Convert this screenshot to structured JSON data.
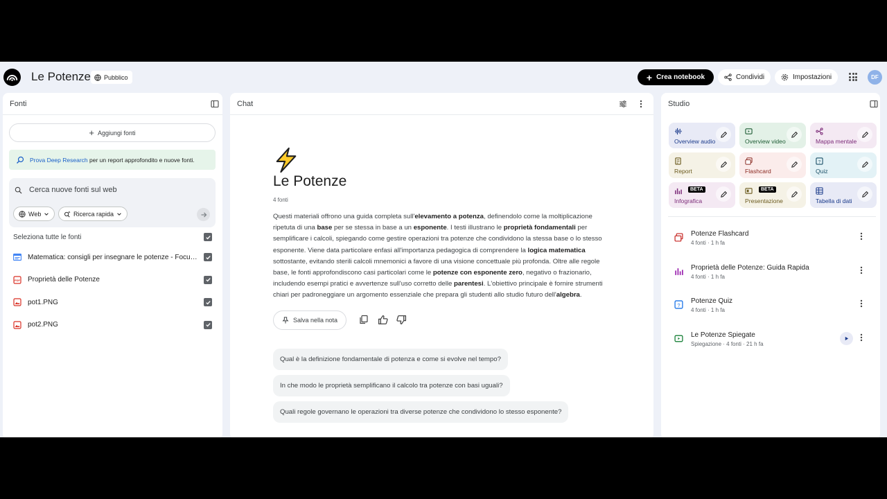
{
  "header": {
    "title": "Le Potenze",
    "visibility": "Pubblico",
    "create_label": "Crea notebook",
    "share_label": "Condividi",
    "settings_label": "Impostazioni",
    "avatar_initials": "DF"
  },
  "sources": {
    "title": "Fonti",
    "add_label": "Aggiungi fonti",
    "deep_link": "Prova Deep Research",
    "deep_text": " per un report approfondito e nuove fonti.",
    "search_placeholder": "Cerca nuove fonti sul web",
    "web_chip": "Web",
    "mode_chip": "Ricerca rapida",
    "select_all": "Seleziona tutte le fonti",
    "items": [
      {
        "label": "Matematica: consigli per insegnare le potenze - Focus Scuola",
        "icon": "doc-icon",
        "color": "#4285f4"
      },
      {
        "label": "Proprietà delle Potenze",
        "icon": "pdf-icon",
        "color": "#d93025"
      },
      {
        "label": "pot1.PNG",
        "icon": "image-icon",
        "color": "#d93025"
      },
      {
        "label": "pot2.PNG",
        "icon": "image-icon",
        "color": "#d93025"
      }
    ]
  },
  "chat": {
    "title": "Chat",
    "emoji": "⚡",
    "notebook_title": "Le Potenze",
    "source_count": "4 fonti",
    "summary": [
      {
        "t": "Questi materiali offrono una guida completa sull'",
        "b": false
      },
      {
        "t": "elevamento a potenza",
        "b": true
      },
      {
        "t": ", definendolo come la moltiplicazione ripetuta di una ",
        "b": false
      },
      {
        "t": "base",
        "b": true
      },
      {
        "t": " per se stessa in base a un ",
        "b": false
      },
      {
        "t": "esponente",
        "b": true
      },
      {
        "t": ". I testi illustrano le ",
        "b": false
      },
      {
        "t": "proprietà fondamentali",
        "b": true
      },
      {
        "t": " per semplificare i calcoli, spiegando come gestire operazioni tra potenze che condividono la stessa base o lo stesso esponente. Viene data particolare enfasi all'importanza pedagogica di comprendere la ",
        "b": false
      },
      {
        "t": "logica matematica",
        "b": true
      },
      {
        "t": " sottostante, evitando sterili calcoli mnemonici a favore di una visione concettuale più profonda. Oltre alle regole base, le fonti approfondiscono casi particolari come le ",
        "b": false
      },
      {
        "t": "potenze con esponente zero",
        "b": true
      },
      {
        "t": ", negativo o frazionario, includendo esempi pratici e avvertenze sull'uso corretto delle ",
        "b": false
      },
      {
        "t": "parentesi",
        "b": true
      },
      {
        "t": ". L'obiettivo principale è fornire strumenti chiari per padroneggiare un argomento essenziale che prepara gli studenti allo studio futuro dell'",
        "b": false
      },
      {
        "t": "algebra",
        "b": true
      },
      {
        "t": ".",
        "b": false
      }
    ],
    "save_note_label": "Salva nella nota",
    "suggestions": [
      "Qual è la definizione fondamentale di potenza e come si evolve nel tempo?",
      "In che modo le proprietà semplificano il calcolo tra potenze con basi uguali?",
      "Quali regole governano le operazioni tra diverse potenze che condividono lo stesso esponente?"
    ]
  },
  "studio": {
    "title": "Studio",
    "tiles": [
      {
        "label": "Overview audio",
        "bg": "#e8eaf6",
        "fg": "#1a3a8a",
        "icon": "audio-icon",
        "beta": false
      },
      {
        "label": "Overview video",
        "bg": "#e3f1e7",
        "fg": "#1e5c34",
        "icon": "video-icon",
        "beta": false
      },
      {
        "label": "Mappa mentale",
        "bg": "#f4e9f3",
        "fg": "#7b2a78",
        "icon": "mindmap-icon",
        "beta": false
      },
      {
        "label": "Report",
        "bg": "#f5f2e6",
        "fg": "#6b5a1e",
        "icon": "report-icon",
        "beta": false
      },
      {
        "label": "Flashcard",
        "bg": "#fbeceb",
        "fg": "#8a2a22",
        "icon": "flashcard-icon",
        "beta": false
      },
      {
        "label": "Quiz",
        "bg": "#e3f2f6",
        "fg": "#1a4f66",
        "icon": "quiz-icon",
        "beta": false
      },
      {
        "label": "Infografica",
        "bg": "#f4e9f3",
        "fg": "#7b2a78",
        "icon": "infographic-icon",
        "beta": true
      },
      {
        "label": "Presentazione",
        "bg": "#f5f2e6",
        "fg": "#6b5a1e",
        "icon": "slides-icon",
        "beta": true
      },
      {
        "label": "Tabella di dati",
        "bg": "#e8eaf6",
        "fg": "#1a3a8a",
        "icon": "table-icon",
        "beta": false
      }
    ],
    "beta_label": "BETA",
    "notes": [
      {
        "title": "Potenze Flashcard",
        "meta": "4 fonti · 1 h fa",
        "icon": "flashcard-icon",
        "color": "#c5221f"
      },
      {
        "title": "Proprietà delle Potenze: Guida Rapida",
        "meta": "4 fonti · 1 h fa",
        "icon": "infographic-icon",
        "color": "#9c27b0"
      },
      {
        "title": "Potenze Quiz",
        "meta": "4 fonti · 1 h fa",
        "icon": "quiz-icon",
        "color": "#1a73e8"
      },
      {
        "title": "Le Potenze Spiegate",
        "meta": "Spiegazione · 4 fonti · 21 h fa",
        "icon": "video-icon",
        "color": "#188038"
      }
    ]
  }
}
